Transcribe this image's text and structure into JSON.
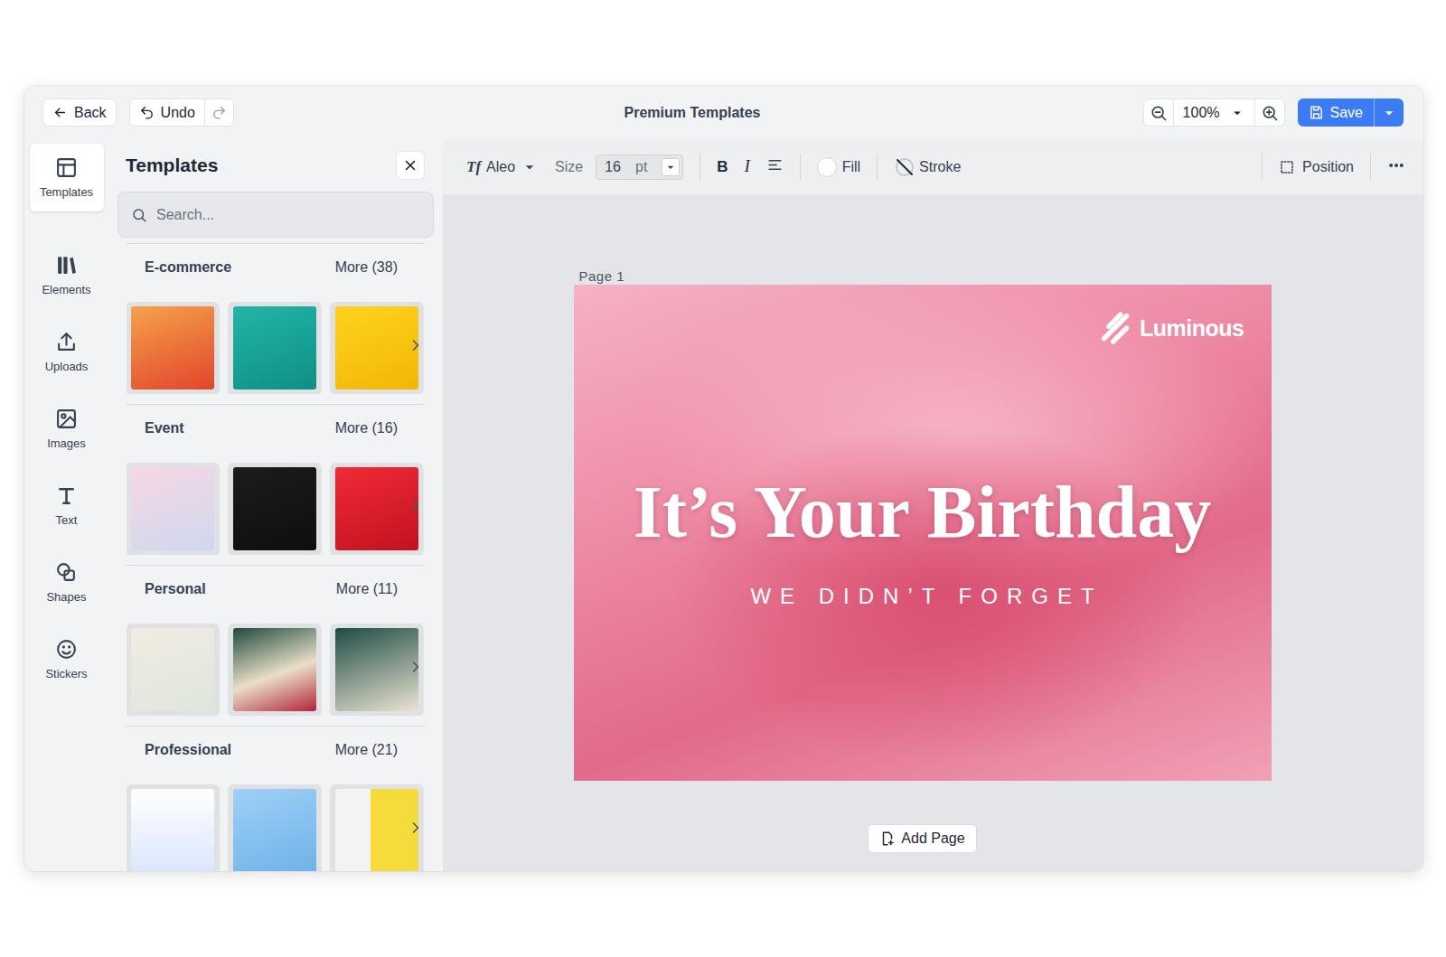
{
  "window": {
    "title": "Premium Templates"
  },
  "topbar": {
    "back": "Back",
    "undo": "Undo",
    "zoom": "100%",
    "save": "Save"
  },
  "rail": {
    "items": [
      {
        "label": "Templates",
        "selected": true
      },
      {
        "label": "Elements",
        "selected": false
      },
      {
        "label": "Uploads",
        "selected": false
      },
      {
        "label": "Images",
        "selected": false
      },
      {
        "label": "Text",
        "selected": false
      },
      {
        "label": "Shapes",
        "selected": false
      },
      {
        "label": "Stickers",
        "selected": false
      }
    ]
  },
  "panel": {
    "title": "Templates",
    "search": {
      "placeholder": "Search..."
    },
    "categories": [
      {
        "name": "E-commerce",
        "more": "More (38)"
      },
      {
        "name": "Event",
        "more": "More (16)"
      },
      {
        "name": "Personal",
        "more": "More (11)"
      },
      {
        "name": "Professional",
        "more": "More (21)"
      }
    ]
  },
  "format_bar": {
    "font_icon": "Tf",
    "font": "Aleo",
    "size_label": "Size",
    "size": "16",
    "unit": "pt",
    "bold": "B",
    "italic": "I",
    "fill": {
      "label": "Fill",
      "color": "#ffffff"
    },
    "stroke": "Stroke",
    "position": "Position"
  },
  "canvas": {
    "page_label": "Page 1",
    "brand": "Luminous",
    "headline": "It’s Your Birthday",
    "subline": "WE DIDN’T FORGET",
    "add_page": "Add Page"
  }
}
